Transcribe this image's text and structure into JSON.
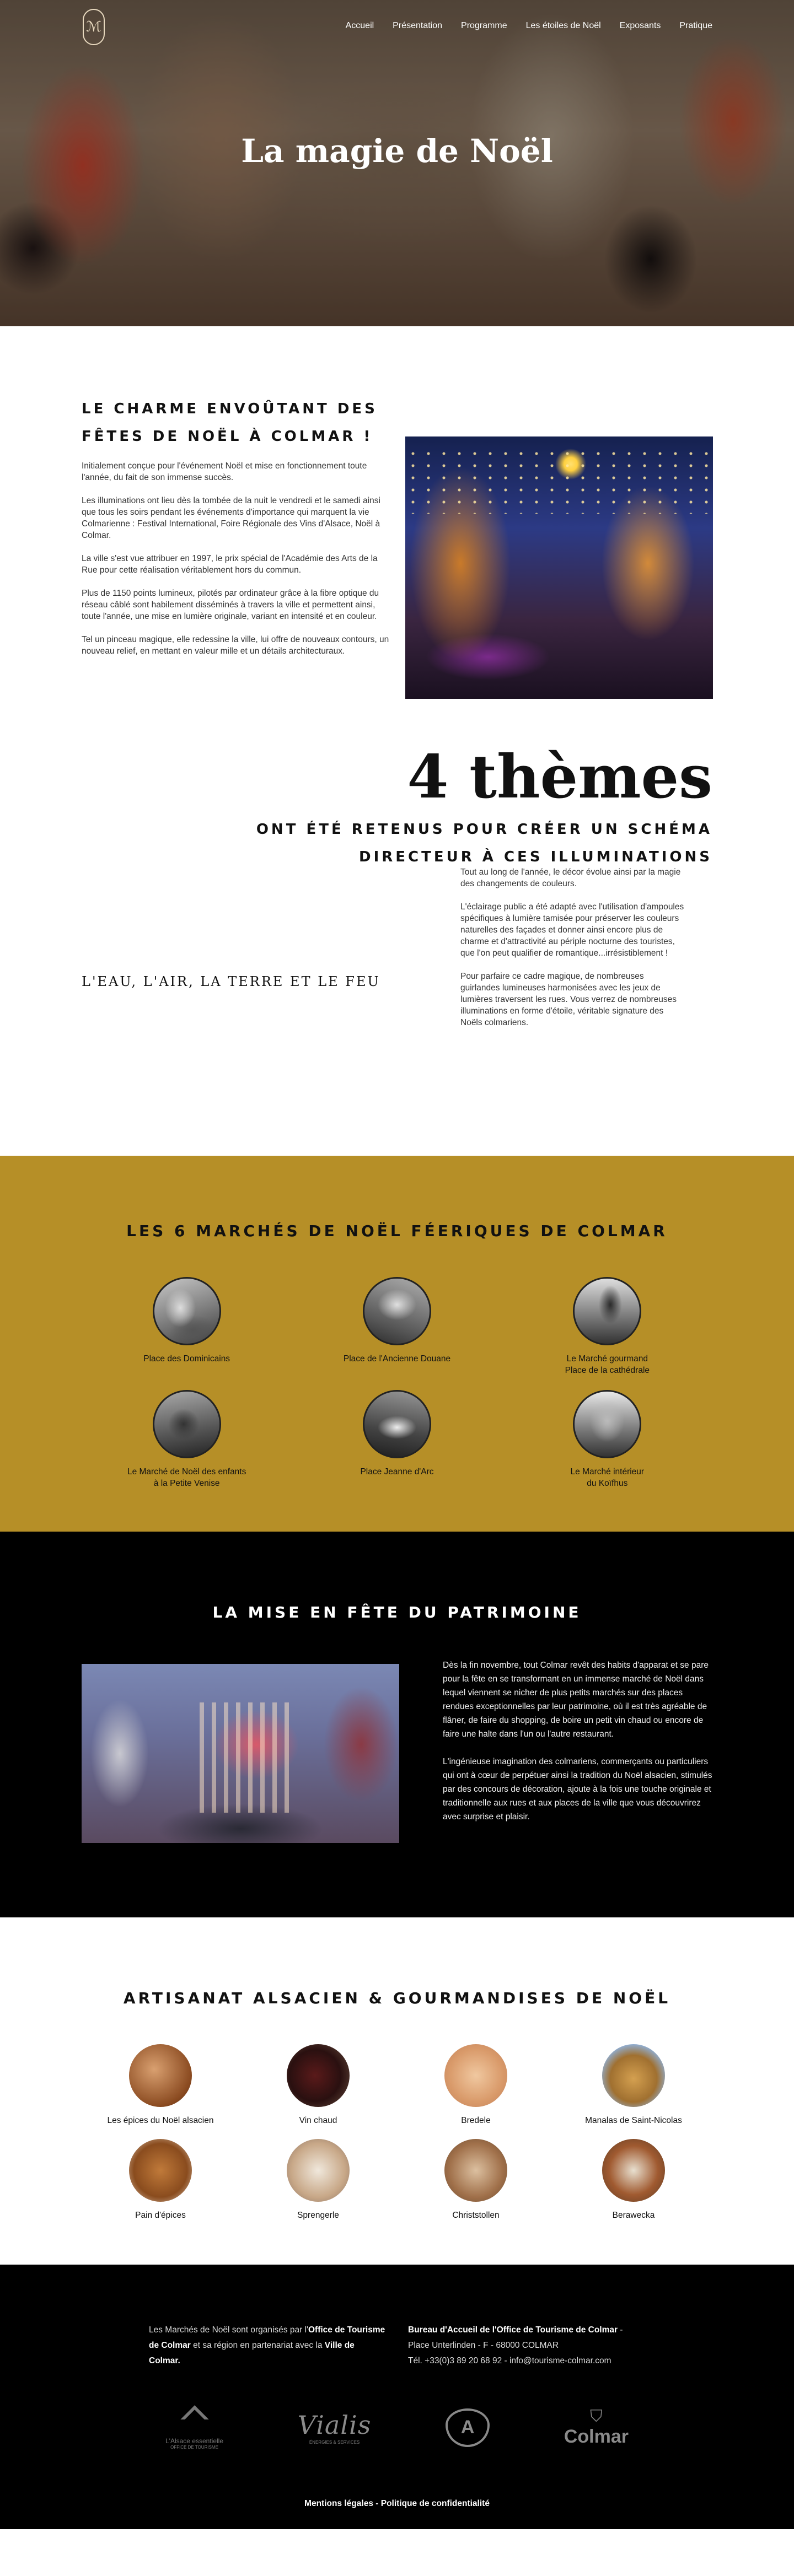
{
  "header": {
    "logo_text": "ℳ",
    "menu": [
      "Accueil",
      "Présentation",
      "Programme",
      "Les étoiles de Noël",
      "Exposants",
      "Pratique"
    ],
    "hero_title": "La magie de Noël"
  },
  "charme": {
    "title": "Le charme envoûtant des fêtes de Noël à Colmar !",
    "paragraphs": [
      "Initialement conçue pour l'événement Noël et mise en fonctionnement toute l'année, du fait de son immense succès.",
      "Les illuminations ont lieu dès la tombée de la nuit le vendredi et le samedi ainsi que tous les soirs pendant les événements d'importance qui marquent la vie Colmarienne : Festival International, Foire Régionale des Vins d'Alsace, Noël à Colmar.",
      "La ville s'est vue attribuer en 1997, le prix spécial de l'Académie des Arts de la Rue pour cette réalisation véritablement hors du commun.",
      "Plus de 1150 points lumineux, pilotés par ordinateur grâce à la fibre optique du réseau câblé sont habilement disséminés à travers la ville et permettent ainsi, toute l'année, une mise en lumière originale, variant en intensité et en couleur.",
      "Tel un pinceau magique, elle redessine la ville, lui offre de nouveaux contours, un nouveau relief, en mettant en valeur mille et un détails architecturaux."
    ]
  },
  "themes": {
    "big": "4 thèmes",
    "subtitle": "ont été retenus pour créer un schéma directeur à ces illuminations",
    "elements": "L'EAU, L'AIR, LA TERRE ET LE FEU",
    "paragraphs": [
      "Tout au long de l'année, le décor évolue ainsi par la magie des changements de couleurs.",
      "L'éclairage public a été adapté avec l'utilisation d'ampoules spécifiques à lumière tamisée pour préserver les couleurs naturelles des façades et donner ainsi encore plus de charme et d'attractivité au périple nocturne des touristes, que l'on peut qualifier de romantique...irrésistiblement !",
      "Pour parfaire ce cadre magique, de nombreuses guirlandes lumineuses harmonisées avec les jeux de lumières traversent les rues. Vous verrez de nombreuses illuminations en forme d'étoile, véritable signature des Noëls colmariens."
    ]
  },
  "marches": {
    "title": "Les 6 marchés de Noël féeriques de Colmar",
    "items": [
      {
        "label": "Place des Dominicains"
      },
      {
        "label": "Place de l'Ancienne Douane"
      },
      {
        "label": "Le Marché gourmand\nPlace de la cathédrale"
      },
      {
        "label": "Le Marché de Noël des enfants\nà la Petite Venise"
      },
      {
        "label": "Place Jeanne d'Arc"
      },
      {
        "label": "Le Marché intérieur\ndu Koïfhus"
      }
    ]
  },
  "patrimoine": {
    "title": "La mise en fête du patrimoine",
    "paragraphs": [
      "Dès la fin novembre, tout Colmar revêt des habits d'apparat et se pare pour la fête en se transformant en un immense marché de Noël dans lequel viennent se nicher de plus petits marchés sur des places rendues exceptionnelles par leur patrimoine, où il est très agréable de flâner, de faire du shopping, de boire un petit vin chaud ou encore de faire une halte dans l'un ou l'autre restaurant.",
      "L'ingénieuse imagination des colmariens, commerçants ou particuliers qui ont  à cœur de perpétuer ainsi la tradition du Noël alsacien, stimulés par des concours de décoration, ajoute à la fois une touche originale et traditionnelle aux rues et aux places de la ville que vous découvrirez avec surprise et plaisir."
    ]
  },
  "artisanat": {
    "title": "Artisanat alsacien & gourmandises de Noël",
    "items": [
      {
        "label": "Les épices du Noël alsacien"
      },
      {
        "label": "Vin chaud"
      },
      {
        "label": "Bredele"
      },
      {
        "label": "Manalas de Saint-Nicolas"
      },
      {
        "label": "Pain d'épices"
      },
      {
        "label": "Sprengerle"
      },
      {
        "label": "Christstollen"
      },
      {
        "label": "Berawecka"
      }
    ]
  },
  "footer": {
    "col1_pre": "Les Marchés de Noël sont organisés par l'",
    "col1_bold1": "Office de Tourisme de Colmar",
    "col1_mid": " et sa région en partenariat avec la ",
    "col1_bold2": "Ville de Colmar.",
    "col2_bold": "Bureau d'Accueil de l'Office de Tourisme de Colmar",
    "col2_dash": " -",
    "col2_line2": "Place Unterlinden - F - 68000 COLMAR",
    "col2_line3": "Tél. +33(0)3 89 20 68 92 - info@tourisme-colmar.com",
    "partners": [
      {
        "name": "L'Alsace essentielle",
        "sub": "OFFICE DE TOURISME"
      },
      {
        "name": "Vialis",
        "sub": "ÉNERGIES & SERVICES"
      },
      {
        "name": "",
        "sub": ""
      },
      {
        "name": "Colmar",
        "sub": ""
      }
    ],
    "links": [
      "Mentions légales",
      "Politique de confidentialité"
    ],
    "link_sep": " - "
  }
}
